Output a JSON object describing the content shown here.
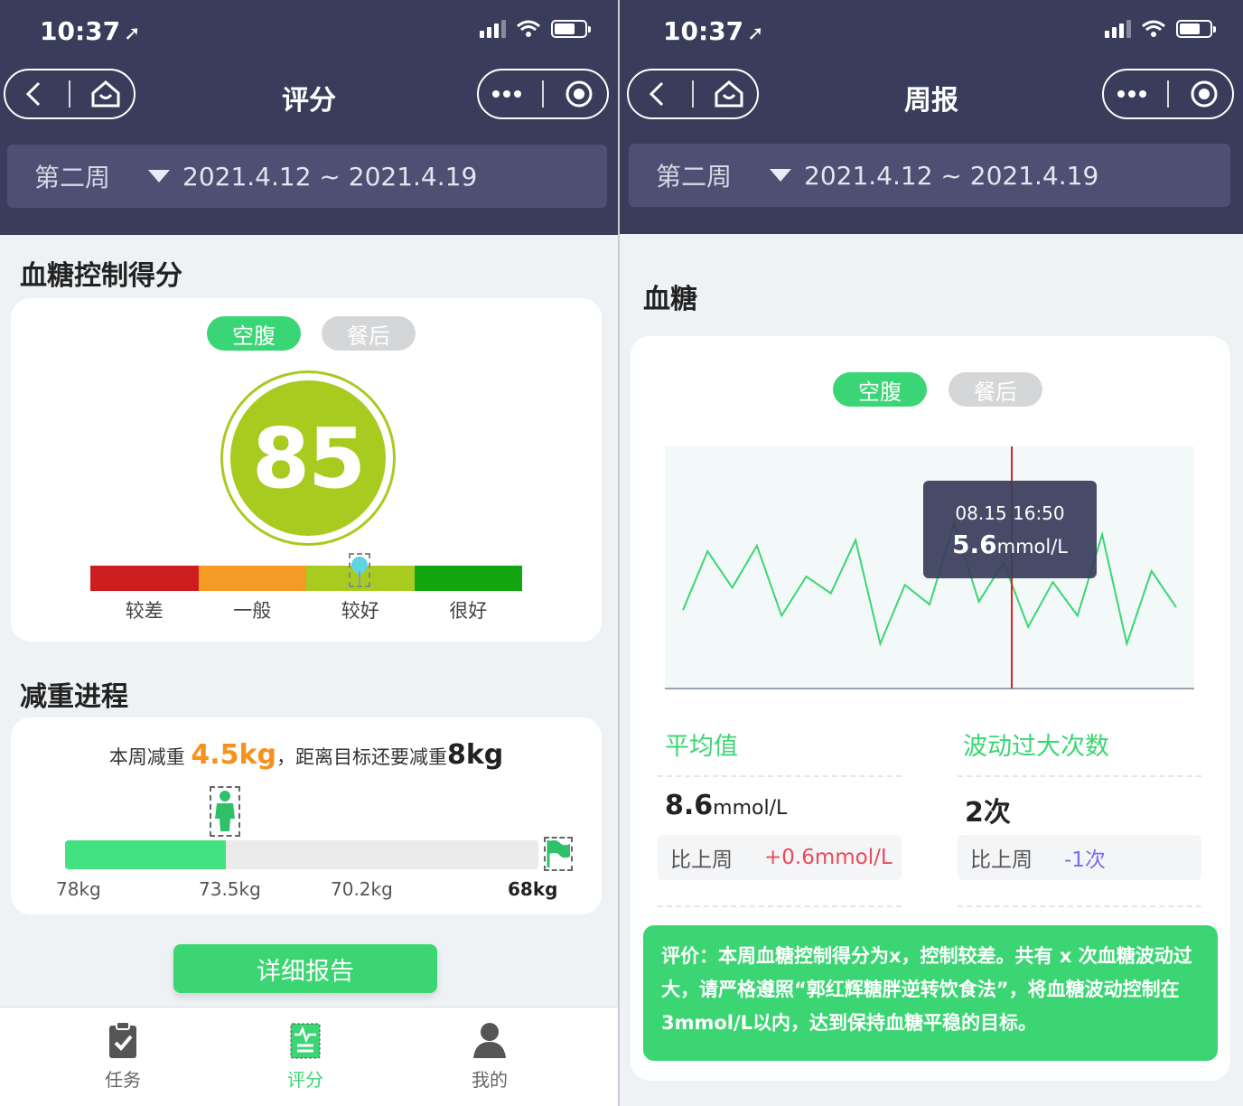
{
  "status": {
    "time": "10:37"
  },
  "left": {
    "nav_title": "评分",
    "week_label": "第二周",
    "date_range": "2021.4.12 ~ 2021.4.19",
    "score_section_title": "血糖控制得分",
    "toggle": {
      "active": "空腹",
      "inactive": "餐后"
    },
    "score": "85",
    "score_color": "#a8cb1f",
    "scale": [
      {
        "label": "较差",
        "color": "#cc1e1e"
      },
      {
        "label": "一般",
        "color": "#f59a25"
      },
      {
        "label": "较好",
        "color": "#a8cb1f"
      },
      {
        "label": "很好",
        "color": "#13a510"
      }
    ],
    "weight_section_title": "减重进程",
    "weight": {
      "prefix": "本周减重 ",
      "lost": "4.5kg",
      "middle": "，距离目标还要减重",
      "remaining": "8kg",
      "progress_fraction": 0.34,
      "labels": [
        "78kg",
        "73.5kg",
        "70.2kg",
        "68kg"
      ]
    },
    "detail_button": "详细报告",
    "tabs": [
      {
        "label": "任务",
        "icon": "clipboard-check-icon"
      },
      {
        "label": "评分",
        "icon": "report-icon",
        "active": true
      },
      {
        "label": "我的",
        "icon": "user-icon"
      }
    ]
  },
  "right": {
    "nav_title": "周报",
    "week_label": "第二周",
    "date_range": "2021.4.12 ~ 2021.4.19",
    "section_title": "血糖",
    "toggle": {
      "active": "空腹",
      "inactive": "餐后"
    },
    "tooltip": {
      "time": "08.15 16:50",
      "value": "5.6",
      "unit": "mmol/L"
    },
    "stats": {
      "avg_label": "平均值",
      "avg_value": "8.6",
      "avg_unit": "mmol/L",
      "avg_cmp_label": "比上周",
      "avg_cmp_value": "+0.6mmol/L",
      "fluct_label": "波动过大次数",
      "fluct_value": "2次",
      "fluct_cmp_label": "比上周",
      "fluct_cmp_value": "-1次"
    },
    "evaluation": "评价：本周血糖控制得分为x，控制较差。共有 x 次血糖波动过大，请严格遵照“郭红辉糖胖逆转饮食法”，将血糖波动控制在3mmol/L以内，达到保持血糖平稳的目标。",
    "chart_data": {
      "type": "line",
      "series": [
        {
          "values": [
            4.8,
            6.9,
            5.6,
            7.1,
            4.6,
            6.0,
            5.4,
            7.3,
            3.6,
            5.7,
            5.0,
            7.9,
            5.1,
            6.5,
            4.2,
            5.8,
            4.6,
            7.5,
            3.6,
            6.2,
            4.9
          ]
        }
      ],
      "highlight": {
        "x_label": "08.15 16:50",
        "value": 5.6
      },
      "grid": false,
      "line_color": "#3bd673",
      "marker_color": "#e02020"
    }
  }
}
